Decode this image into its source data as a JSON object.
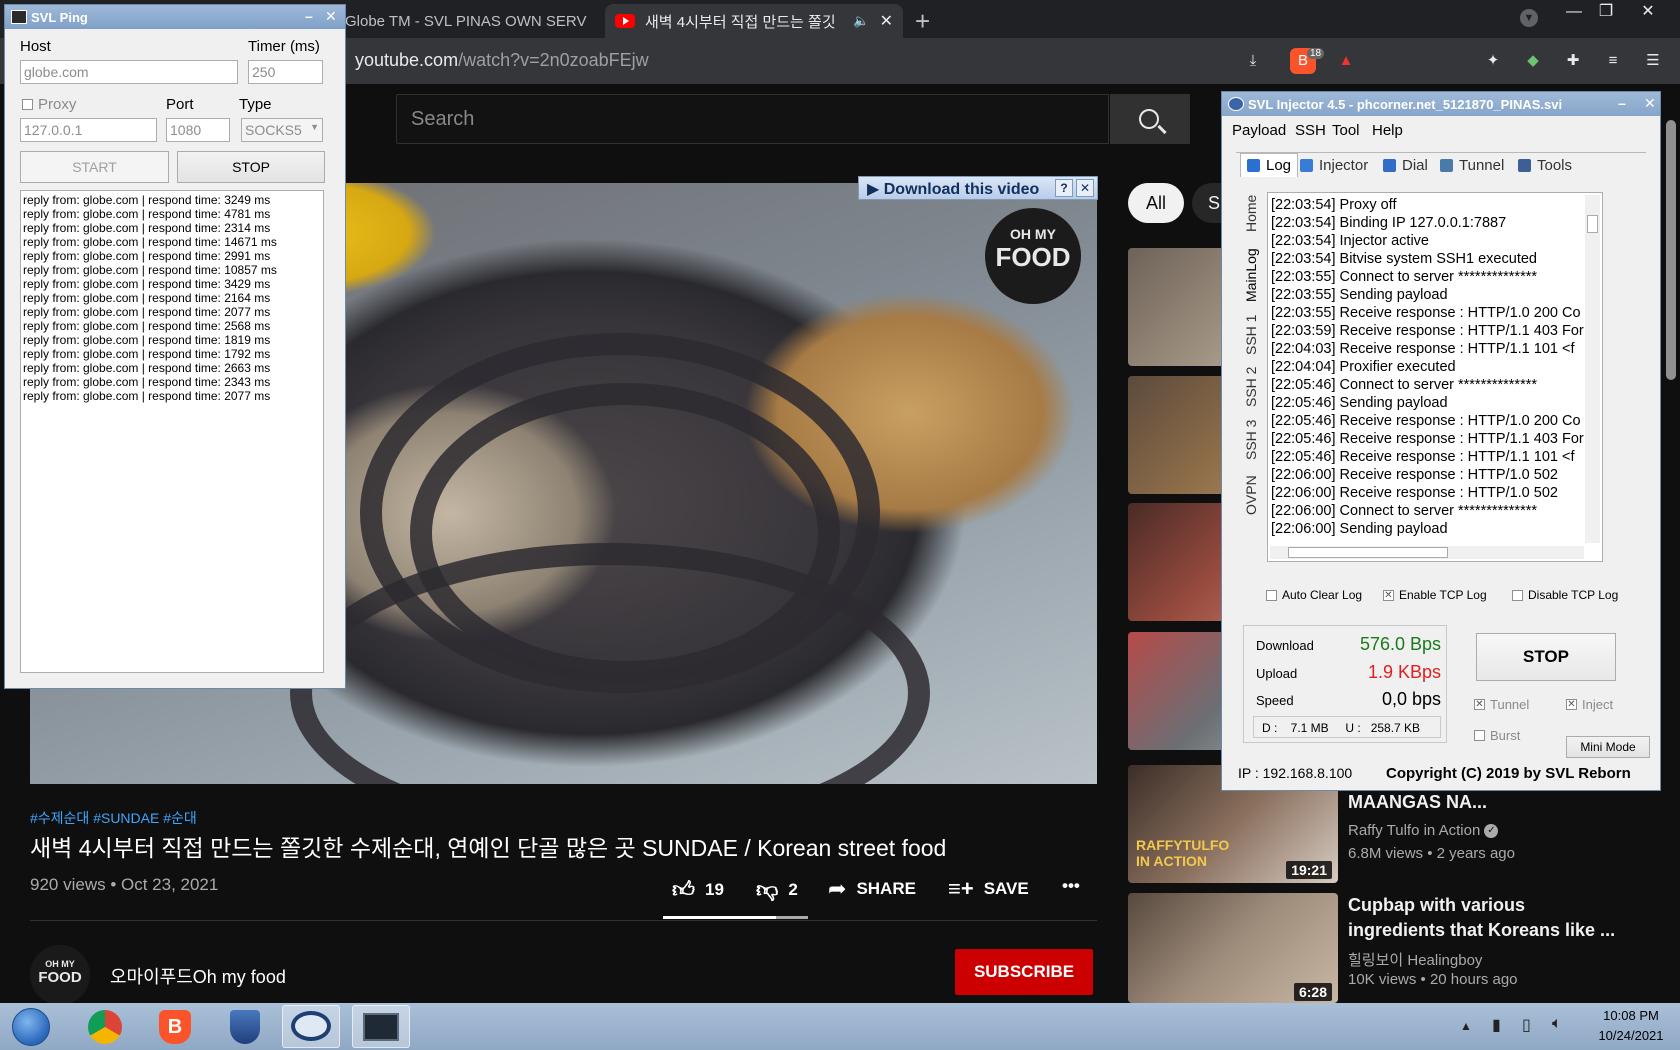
{
  "browser": {
    "tabs": [
      {
        "title": "Globe TM - SVL PINAS OWN SERVER C",
        "active": false
      },
      {
        "title": "새벽 4시부터 직접 만드는 쫄깃",
        "active": true
      }
    ],
    "new_tab": "+",
    "url_host": "youtube.com",
    "url_path": "/watch?v=2n0zoabFEjw",
    "brave_badge": "18"
  },
  "youtube": {
    "search_placeholder": "Search",
    "chips": [
      "All",
      "S"
    ],
    "video_badge": {
      "line1": "OH MY",
      "line2": "FOOD"
    },
    "download_bar": "Download this video",
    "hashtags": "#수제순대 #SUNDAE #순대",
    "title": "새벽 4시부터 직접 만드는 쫄깃한 수제순대, 연예인 단골 많은 곳 SUNDAE / Korean street food",
    "meta": "920 views • Oct 23, 2021",
    "likes": "19",
    "dislikes": "2",
    "share": "SHARE",
    "save": "SAVE",
    "more": "•••",
    "channel": {
      "name": "오마이푸드Oh my food",
      "avatar_l1": "OH MY",
      "avatar_l2": "FOOD"
    },
    "subscribe": "SUBSCRIBE",
    "related": [
      {
        "duration": ""
      },
      {
        "duration": ""
      },
      {
        "duration": ""
      },
      {
        "duration": ""
      },
      {
        "title": "MAANGAS NA...",
        "channel": "Raffy Tulfo in Action",
        "meta": "6.8M views • 2 years ago",
        "duration": "19:21",
        "thumb_text": "RAFFYTULFO IN ACTION"
      },
      {
        "title": "Cupbap with various ingredients that Koreans like ...",
        "channel": "힐링보이 Healingboy",
        "meta": "10K views • 20 hours ago",
        "duration": "6:28"
      }
    ]
  },
  "ping": {
    "window_title": "SVL Ping",
    "host_label": "Host",
    "host_value": "globe.com",
    "timer_label": "Timer (ms)",
    "timer_value": "250",
    "proxy_label": "Proxy",
    "proxy_value": "127.0.0.1",
    "port_label": "Port",
    "port_value": "1080",
    "type_label": "Type",
    "type_value": "SOCKS5",
    "start": "START",
    "stop": "STOP",
    "log": [
      "reply from: globe.com | respond time: 3249 ms",
      "reply from: globe.com | respond time: 4781 ms",
      "reply from: globe.com | respond time: 2314 ms",
      "reply from: globe.com | respond time: 14671 ms",
      "reply from: globe.com | respond time: 2991 ms",
      "reply from: globe.com | respond time: 10857 ms",
      "reply from: globe.com | respond time: 3429 ms",
      "reply from: globe.com | respond time: 2164 ms",
      "reply from: globe.com | respond time: 2077 ms",
      "reply from: globe.com | respond time: 2568 ms",
      "reply from: globe.com | respond time: 1819 ms",
      "reply from: globe.com | respond time: 1792 ms",
      "reply from: globe.com | respond time: 2663 ms",
      "reply from: globe.com | respond time: 2343 ms",
      "reply from: globe.com | respond time: 2077 ms"
    ]
  },
  "injector": {
    "window_title": "SVL Injector 4.5 - phcorner.net_5121870_PINAS.svi",
    "menu": [
      "Payload",
      "SSH",
      "Tool",
      "Help"
    ],
    "tabs": [
      "Log",
      "Injector",
      "Dial",
      "Tunnel",
      "Tools"
    ],
    "side_tabs": [
      "Home",
      "MainLog",
      "SSH 1",
      "SSH 2",
      "SSH 3",
      "OVPN"
    ],
    "log": [
      "[22:03:54] Proxy off",
      "[22:03:54] Binding IP 127.0.0.1:7887",
      "[22:03:54] Injector active",
      "[22:03:54] Bitvise system SSH1 executed",
      "[22:03:55] Connect to server **************",
      "[22:03:55] Sending payload",
      "[22:03:55] Receive response : HTTP/1.0 200 Co",
      "[22:03:59] Receive response : HTTP/1.1 403 For",
      "[22:04:03] Receive response : HTTP/1.1 101 <f",
      "[22:04:04] Proxifier executed",
      "[22:05:46] Connect to server **************",
      "[22:05:46] Sending payload",
      "[22:05:46] Receive response : HTTP/1.0 200 Co",
      "[22:05:46] Receive response : HTTP/1.1 403 For",
      "[22:05:46] Receive response : HTTP/1.1 101 <f",
      "[22:06:00] Receive response : HTTP/1.0 502",
      "[22:06:00] Receive response : HTTP/1.0 502",
      "[22:06:00] Connect to server **************",
      "[22:06:00] Sending payload"
    ],
    "auto_clear": "Auto Clear Log",
    "enable_tcp": "Enable TCP Log",
    "disable_tcp": "Disable TCP Log",
    "download_label": "Download",
    "download_value": "576.0 Bps",
    "upload_label": "Upload",
    "upload_value": "1.9 KBps",
    "speed_label": "Speed",
    "speed_value": "0,0 bps",
    "totals": "D :    7.1 MB     U :   258.7 KB",
    "stop": "STOP",
    "tunnel": "Tunnel",
    "inject": "Inject",
    "burst": "Burst",
    "mini_mode": "Mini Mode",
    "ip": "IP : 192.168.8.100",
    "copyright": "Copyright (C) 2019 by SVL Reborn",
    "colors": {
      "download": "#1a7a1a",
      "upload": "#e02020"
    }
  },
  "taskbar": {
    "time": "10:08 PM",
    "date": "10/24/2021"
  }
}
